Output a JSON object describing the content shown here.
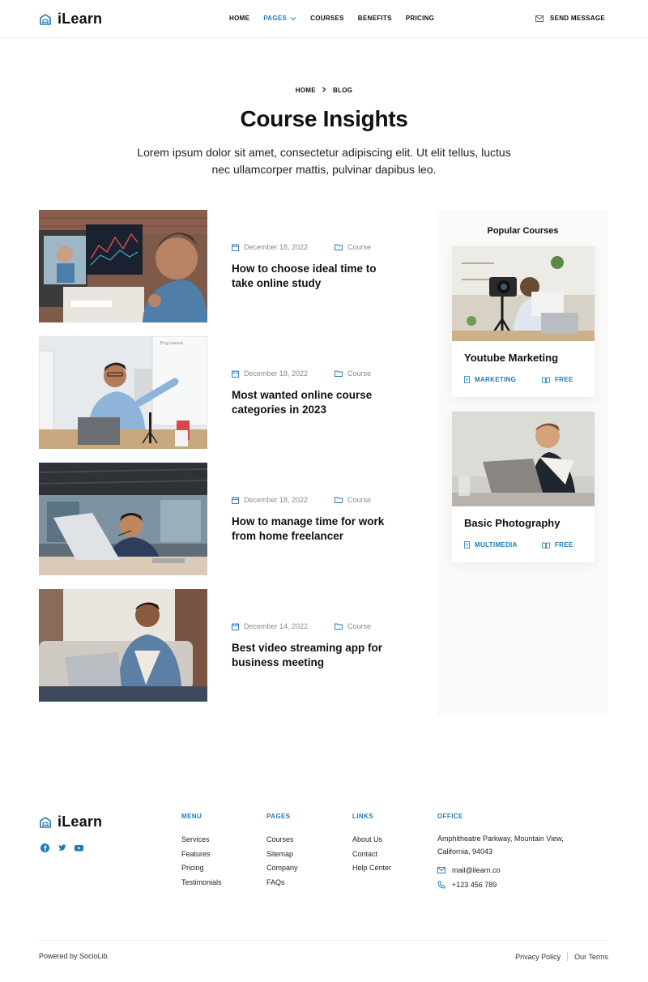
{
  "brand": {
    "name": "iLearn",
    "accent": "#1f7bb6"
  },
  "nav": {
    "items": [
      {
        "label": "HOME",
        "active": false
      },
      {
        "label": "PAGES",
        "active": true,
        "dropdown": true
      },
      {
        "label": "COURSES",
        "active": false
      },
      {
        "label": "BENEFITS",
        "active": false
      },
      {
        "label": "PRICING",
        "active": false
      }
    ],
    "send_message": "SEND MESSAGE"
  },
  "breadcrumb": {
    "home": "HOME",
    "current": "BLOG"
  },
  "hero": {
    "title": "Course Insights",
    "subtitle": "Lorem ipsum dolor sit amet, consectetur adipiscing elit. Ut elit tellus, luctus nec ullamcorper mattis, pulvinar dapibus leo."
  },
  "posts": [
    {
      "date": "December 18, 2022",
      "category": "Course",
      "title": "How to choose ideal time to take online study"
    },
    {
      "date": "December 18, 2022",
      "category": "Course",
      "title": "Most wanted online course categories in 2023"
    },
    {
      "date": "December 18, 2022",
      "category": "Course",
      "title": "How to manage time for work from home freelancer"
    },
    {
      "date": "December 14, 2022",
      "category": "Course",
      "title": "Best video streaming app for business meeting"
    }
  ],
  "sidebar": {
    "title": "Popular Courses",
    "courses": [
      {
        "title": "Youtube Marketing",
        "category": "MARKETING",
        "price": "FREE"
      },
      {
        "title": "Basic Photography",
        "category": "MULTIMEDIA",
        "price": "FREE"
      }
    ]
  },
  "footer": {
    "brand": "iLearn",
    "menu": {
      "heading": "MENU",
      "links": [
        "Services",
        "Features",
        "Pricing",
        "Testimonials"
      ]
    },
    "pages": {
      "heading": "PAGES",
      "links": [
        "Courses",
        "Sitemap",
        "Company",
        "FAQs"
      ]
    },
    "links": {
      "heading": "LINKS",
      "links": [
        "About Us",
        "Contact",
        "Help Center"
      ]
    },
    "office": {
      "heading": "OFFICE",
      "address": "Amphitheatre Parkway, Mountain View, California, 94043",
      "email": "mail@ilearn.co",
      "phone": "+123 456 789"
    },
    "powered": "Powered by SocioLib.",
    "privacy": "Privacy Policy",
    "terms": "Our Terms"
  }
}
